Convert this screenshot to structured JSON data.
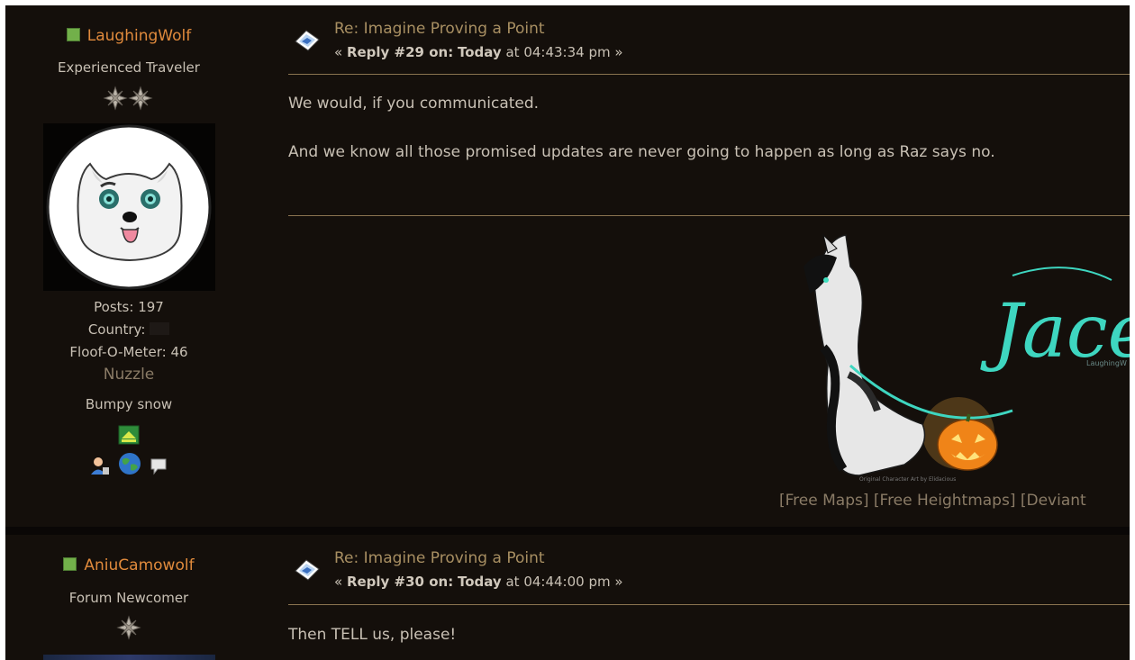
{
  "posts": [
    {
      "poster": {
        "name": "LaughingWolf",
        "rank": "Experienced Traveler",
        "posts": "Posts: 197",
        "country_label": "Country:",
        "floof": "Floof-O-Meter: 46",
        "nuzzle": "Nuzzle",
        "custom_text": "Bumpy snow"
      },
      "subject": "Re: Imagine Proving a Point",
      "reply_label": "Reply #29 on:",
      "reply_day": "Today",
      "reply_time": " at 04:43:34 pm »",
      "body_lines": [
        "We would, if you communicated.",
        "And we know all those promised updates are never going to happen as long as Raz says no."
      ],
      "signature": {
        "banner_text": "Jace",
        "banner_sub": "LaughingW",
        "credit": "Original Character Art by Elidacious",
        "links": [
          "[Free Maps]",
          "[Free Heightmaps]",
          "[Deviant"
        ]
      }
    },
    {
      "poster": {
        "name": "AniuCamowolf",
        "rank": "Forum Newcomer"
      },
      "subject": "Re: Imagine Proving a Point",
      "reply_label": "Reply #30 on:",
      "reply_day": "Today",
      "reply_time": " at 04:44:00 pm »",
      "body_lines": [
        "Then TELL us, please!"
      ]
    }
  ],
  "keyinfo_prefix": "« ",
  "colors": {
    "background": "#140f0b",
    "username": "#e08a3c",
    "subject": "#a88f62",
    "divider": "#8a7350",
    "online": "#72b04a"
  },
  "icons": [
    "post-xx-icon",
    "star-icon",
    "profile-icon",
    "website-icon",
    "personal-message-icon",
    "custom-badge-icon"
  ]
}
